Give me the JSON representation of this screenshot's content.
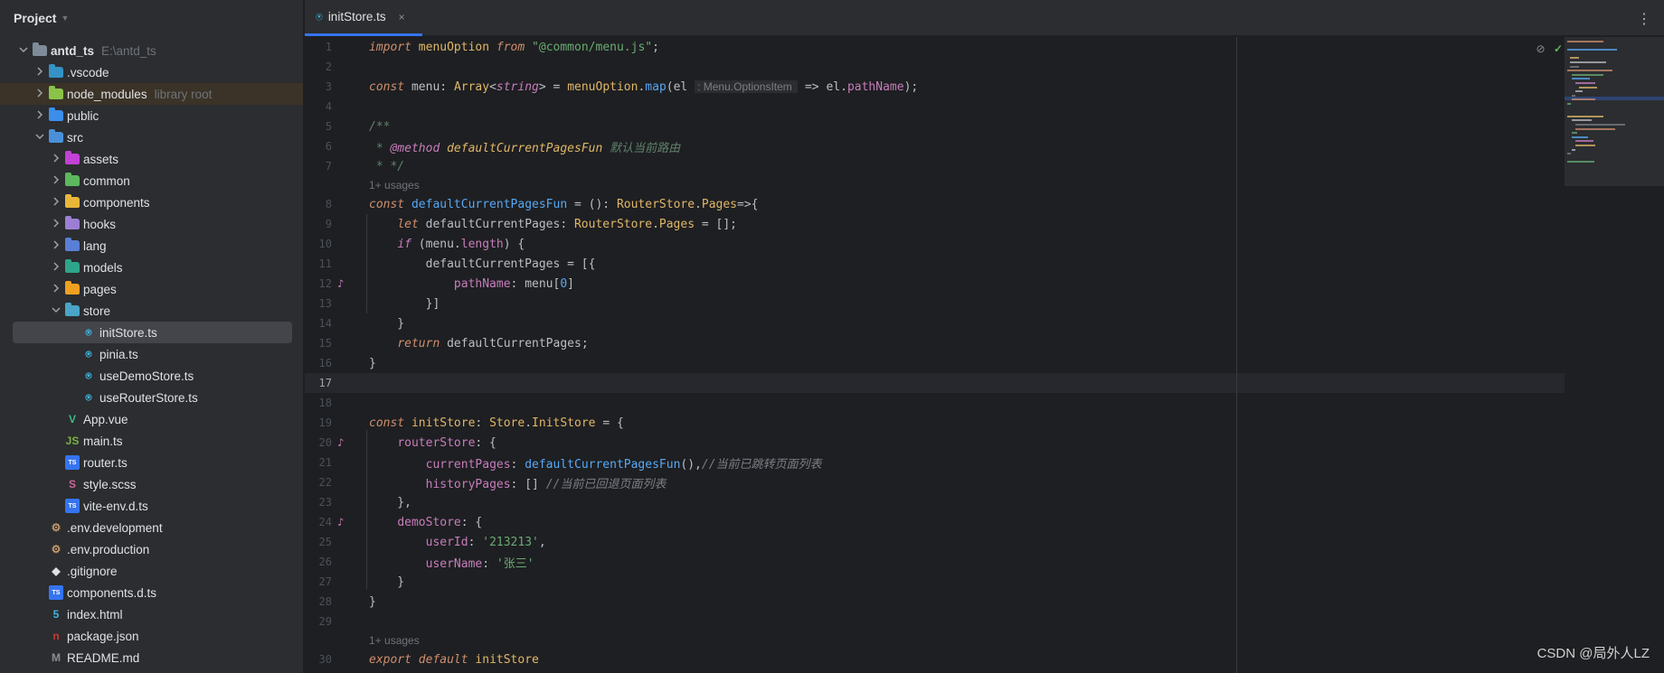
{
  "project": {
    "title": "Project",
    "tree": [
      {
        "label": "antd_ts",
        "hint": "E:\\antd_ts",
        "depth": 0,
        "caret": "open",
        "icon": "folder-icon",
        "color": "#7f8b99",
        "bold": true
      },
      {
        "label": ".vscode",
        "depth": 1,
        "caret": "closed",
        "icon": "folder-icon",
        "color": "#3592c4"
      },
      {
        "label": "node_modules",
        "hint": "library root",
        "depth": 1,
        "caret": "closed",
        "icon": "folder-icon",
        "color": "#8bc34a",
        "highlight": true
      },
      {
        "label": "public",
        "depth": 1,
        "caret": "closed",
        "icon": "folder-icon",
        "color": "#3b8eea"
      },
      {
        "label": "src",
        "depth": 1,
        "caret": "open",
        "icon": "folder-icon",
        "color": "#4a90d9"
      },
      {
        "label": "assets",
        "depth": 2,
        "caret": "closed",
        "icon": "folder-icon",
        "color": "#c241d6"
      },
      {
        "label": "common",
        "depth": 2,
        "caret": "closed",
        "icon": "folder-icon",
        "color": "#5cb85c"
      },
      {
        "label": "components",
        "depth": 2,
        "caret": "closed",
        "icon": "folder-icon",
        "color": "#e8b73a"
      },
      {
        "label": "hooks",
        "depth": 2,
        "caret": "closed",
        "icon": "folder-icon",
        "color": "#9b7fd4"
      },
      {
        "label": "lang",
        "depth": 2,
        "caret": "closed",
        "icon": "folder-icon",
        "color": "#5a7fd6"
      },
      {
        "label": "models",
        "depth": 2,
        "caret": "closed",
        "icon": "folder-icon",
        "color": "#2ea58a"
      },
      {
        "label": "pages",
        "depth": 2,
        "caret": "closed",
        "icon": "folder-icon",
        "color": "#f0a020"
      },
      {
        "label": "store",
        "depth": 2,
        "caret": "open",
        "icon": "folder-icon",
        "color": "#4aa4c8"
      },
      {
        "label": "initStore.ts",
        "depth": 3,
        "icon": "pinia-icon",
        "color": "#40b6e0",
        "selected": true
      },
      {
        "label": "pinia.ts",
        "depth": 3,
        "icon": "pinia-icon",
        "color": "#40b6e0"
      },
      {
        "label": "useDemoStore.ts",
        "depth": 3,
        "icon": "pinia-icon",
        "color": "#40b6e0"
      },
      {
        "label": "useRouterStore.ts",
        "depth": 3,
        "icon": "pinia-icon",
        "color": "#40b6e0"
      },
      {
        "label": "App.vue",
        "depth": 2,
        "icon": "vue-icon",
        "color": "#41b883"
      },
      {
        "label": "main.ts",
        "depth": 2,
        "icon": "node-icon",
        "color": "#7cb342"
      },
      {
        "label": "router.ts",
        "depth": 2,
        "icon": "ts-icon",
        "color": "#3574f0"
      },
      {
        "label": "style.scss",
        "depth": 2,
        "icon": "sass-icon",
        "color": "#cd6799"
      },
      {
        "label": "vite-env.d.ts",
        "depth": 2,
        "icon": "ts-icon",
        "color": "#3574f0"
      },
      {
        "label": ".env.development",
        "depth": 1,
        "icon": "settings-icon",
        "color": "#c49a6c"
      },
      {
        "label": ".env.production",
        "depth": 1,
        "icon": "settings-icon",
        "color": "#c49a6c"
      },
      {
        "label": ".gitignore",
        "depth": 1,
        "icon": "git-icon",
        "color": "#dfe1e5"
      },
      {
        "label": "components.d.ts",
        "depth": 1,
        "icon": "ts-icon",
        "color": "#3574f0"
      },
      {
        "label": "index.html",
        "depth": 1,
        "icon": "html-icon",
        "color": "#40b6e0"
      },
      {
        "label": "package.json",
        "depth": 1,
        "icon": "npm-icon",
        "color": "#cb3837"
      },
      {
        "label": "README.md",
        "depth": 1,
        "icon": "markdown-icon",
        "color": "#8c8f94"
      }
    ]
  },
  "tab": {
    "label": "initStore.ts",
    "close": "×",
    "more": "⋮"
  },
  "editor": {
    "usages": "1+ usages",
    "lines": [
      {
        "n": "1",
        "html": "<span class='kw'>import</span> <span class='id'>menuOption</span> <span class='kw'>from</span> <span class='str'>\"@common/menu.js\"</span>;"
      },
      {
        "n": "2",
        "html": ""
      },
      {
        "n": "3",
        "html": "<span class='kw'>const</span> menu: <span class='type'>Array</span>&lt;<span class='kw2'>string</span>&gt; = <span class='id'>menuOption</span>.<span class='fn'>map</span>(el <span class='hint'>: Menu.OptionsItem </span> =&gt; el.<span class='prop'>pathName</span>);"
      },
      {
        "n": "4",
        "html": ""
      },
      {
        "n": "5",
        "html": "<span class='doc'>/**</span>"
      },
      {
        "n": "6",
        "html": "<span class='doc'> * </span><span class='tag'>@method</span><span class='doc'> </span><span class='type' style='font-style:italic'>defaultCurrentPagesFun</span><span class='doc'> 默认当前路由</span>"
      },
      {
        "n": "7",
        "html": "<span class='doc'> * */</span>",
        "usages_after": true
      },
      {
        "n": "8",
        "html": "<span class='kw'>const</span> <span class='fn'>defaultCurrentPagesFun</span> = (): <span class='type'>RouterStore</span>.<span class='type'>Pages</span>=&gt;{"
      },
      {
        "n": "9",
        "html": "    <span class='kw'>let</span> defaultCurrentPages: <span class='type'>RouterStore</span>.<span class='type'>Pages</span> = [];"
      },
      {
        "n": "10",
        "html": "    <span class='kw2'>if</span> (menu.<span class='prop'>length</span>) {"
      },
      {
        "n": "11",
        "html": "        defaultCurrentPages = [{"
      },
      {
        "n": "12",
        "html": "            <span class='ph'>pathName</span>: menu[<span class='fn'>0</span>]",
        "gutter": "♪"
      },
      {
        "n": "13",
        "html": "        }]"
      },
      {
        "n": "14",
        "html": "    }"
      },
      {
        "n": "15",
        "html": "    <span class='kw'>return</span> defaultCurrentPages;"
      },
      {
        "n": "16",
        "html": "}"
      },
      {
        "n": "17",
        "html": "",
        "current": true
      },
      {
        "n": "18",
        "html": ""
      },
      {
        "n": "19",
        "html": "<span class='kw'>const</span> <span class='id'>initStore</span>: <span class='type'>Store</span>.<span class='type'>InitStore</span> = {"
      },
      {
        "n": "20",
        "html": "    <span class='ph'>routerStore</span>: {",
        "gutter": "♪"
      },
      {
        "n": "21",
        "html": "        <span class='ph'>currentPages</span>: <span class='pf'>defaultCurrentPagesFun</span>(),<span class='cmt'>//当前已跳转页面列表</span>"
      },
      {
        "n": "22",
        "html": "        <span class='ph'>historyPages</span>: [] <span class='cmt'>//当前已回退页面列表</span>"
      },
      {
        "n": "23",
        "html": "    },"
      },
      {
        "n": "24",
        "html": "    <span class='ph'>demoStore</span>: {",
        "gutter": "♪"
      },
      {
        "n": "25",
        "html": "        <span class='ph'>userId</span>: <span class='str'>'213213'</span>,"
      },
      {
        "n": "26",
        "html": "        <span class='ph'>userName</span>: <span class='str'>'张三'</span>"
      },
      {
        "n": "27",
        "html": "    }"
      },
      {
        "n": "28",
        "html": "}"
      },
      {
        "n": "29",
        "html": "",
        "usages_after": true
      },
      {
        "n": "30",
        "html": "<span class='kw'>export</span> <span class='kw'>default</span> <span class='id'>initStore</span>"
      }
    ]
  },
  "inspection": {
    "hidden_icon": "eye-crossed-icon",
    "ok_icon": "checkmark-icon"
  },
  "watermark": "CSDN @局外人LZ"
}
